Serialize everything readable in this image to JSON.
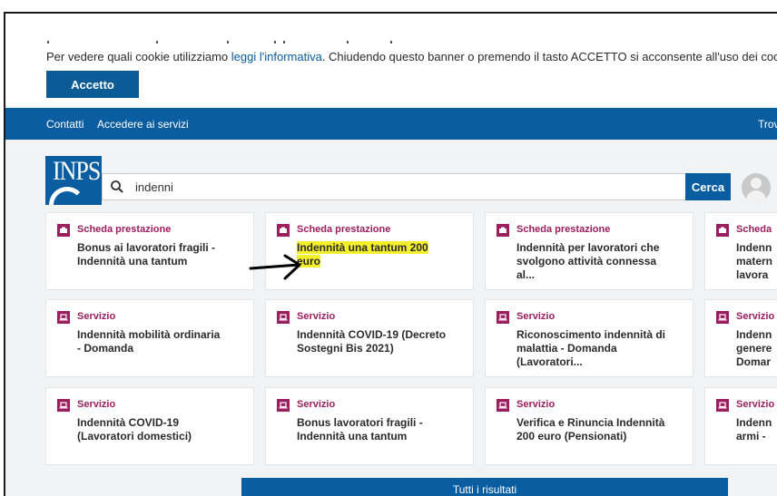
{
  "cookie": {
    "text_before": "Per vedere quali cookie utilizziamo ",
    "link": "leggi l'informativa",
    "text_after": ". Chiudendo questo banner o premendo il tasto ACCETTO si acconsente all'uso dei cookie.",
    "accept_label": "Accetto"
  },
  "topnav": {
    "contacts": "Contatti",
    "services": "Accedere ai servizi",
    "right": "Trov"
  },
  "search": {
    "value": "indenni",
    "button_label": "Cerca"
  },
  "brand": {
    "logo_text": "INPS",
    "primary_color": "#0a5da0",
    "accent_color": "#9b1e5e",
    "highlight_color": "#f3ef2c"
  },
  "results": [
    {
      "type": "Scheda prestazione",
      "icon": "card-icon",
      "lines": [
        "Bonus ai lavoratori fragili -",
        "Indennità una tantum"
      ]
    },
    {
      "type": "Scheda prestazione",
      "icon": "card-icon",
      "lines": [
        "Indennità una tantum 200",
        "euro"
      ],
      "highlighted": true
    },
    {
      "type": "Scheda prestazione",
      "icon": "card-icon",
      "lines": [
        "Indennità per lavoratori che",
        "svolgono attività connessa",
        "al..."
      ]
    },
    {
      "type": "Scheda",
      "icon": "card-icon",
      "lines": [
        "Indenn",
        "matern",
        "lavora"
      ]
    },
    {
      "type": "Servizio",
      "icon": "laptop-icon",
      "lines": [
        "Indennità mobilità ordinaria",
        "- Domanda"
      ]
    },
    {
      "type": "Servizio",
      "icon": "laptop-icon",
      "lines": [
        "Indennità COVID-19 (Decreto",
        "Sostegni Bis 2021)"
      ]
    },
    {
      "type": "Servizio",
      "icon": "laptop-icon",
      "lines": [
        "Riconoscimento indennità di",
        "malattia - Domanda",
        "(Lavoratori..."
      ]
    },
    {
      "type": "Servizio",
      "icon": "laptop-icon",
      "lines": [
        "Indenn",
        "genere",
        "Domar"
      ]
    },
    {
      "type": "Servizio",
      "icon": "laptop-icon",
      "lines": [
        "Indennità COVID-19",
        "(Lavoratori domestici)"
      ]
    },
    {
      "type": "Servizio",
      "icon": "laptop-icon",
      "lines": [
        "Bonus lavoratori fragili -",
        "Indennità una tantum"
      ]
    },
    {
      "type": "Servizio",
      "icon": "laptop-icon",
      "lines": [
        "Verifica e Rinuncia Indennità",
        "200 euro (Pensionati)"
      ]
    },
    {
      "type": "Servizio",
      "icon": "laptop-icon",
      "lines": [
        "Indenn",
        "armi -"
      ]
    }
  ],
  "all_results_label": "Tutti i risultati"
}
